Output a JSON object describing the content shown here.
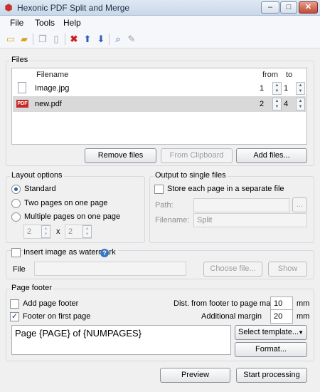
{
  "window": {
    "title": "Hexonic PDF Split and Merge",
    "app_icon": "hexagon-icon",
    "minimize_glyph": "–",
    "maximize_glyph": "□",
    "close_glyph": "✕"
  },
  "menu": [
    "File",
    "Tools",
    "Help"
  ],
  "toolbar": {
    "icons": [
      "new-icon",
      "open-folder-icon",
      "copy-icon",
      "paste-icon",
      "delete-icon",
      "move-up-icon",
      "move-down-icon",
      "search-icon",
      "edit-icon"
    ],
    "glyphs": {
      "new": "▭",
      "open": "▰",
      "copy": "❐",
      "paste": "▯",
      "delete": "✖",
      "up": "⬆",
      "down": "⬇",
      "search": "⌕",
      "edit": "✎"
    }
  },
  "files": {
    "group_label": "Files",
    "columns": {
      "filename": "Filename",
      "from": "from",
      "to": "to"
    },
    "rows": [
      {
        "icon": "blank-file-icon",
        "name": "Image.jpg",
        "from": "1",
        "to": "1",
        "selected": false
      },
      {
        "icon": "pdf-file-icon",
        "name": "new.pdf",
        "from": "2",
        "to": "4",
        "selected": true
      }
    ],
    "pdf_badge": "PDF",
    "buttons": {
      "remove": "Remove files",
      "clipboard": "From Clipboard",
      "add": "Add files..."
    }
  },
  "layout_options": {
    "group_label": "Layout options",
    "options": [
      "Standard",
      "Two pages on one page",
      "Multiple pages on one page"
    ],
    "selected": "Standard",
    "cols": "2",
    "rows": "2",
    "times": "x"
  },
  "output": {
    "group_label": "Output to single files",
    "store_label": "Store each page in a separate file",
    "path_label": "Path:",
    "path_value": "",
    "browse_label": "...",
    "filename_label": "Filename:",
    "filename_value": "Split"
  },
  "watermark": {
    "checkbox_label": "Insert image as watermark",
    "file_label": "File",
    "file_value": "",
    "choose_label": "Choose file...",
    "show_label": "Show",
    "help_glyph": "?"
  },
  "footer": {
    "group_label": "Page footer",
    "add_label": "Add page footer",
    "add_checked": false,
    "first_label": "Footer on first page",
    "first_checked": true,
    "check_glyph": "✓",
    "dist_label": "Dist. from footer to page margin",
    "dist_value": "10",
    "dist_unit": "mm",
    "margin_label": "Additional margin",
    "margin_value": "20",
    "margin_unit": "mm",
    "text": "Page {PAGE} of {NUMPAGES}",
    "template_label": "Select template...",
    "format_label": "Format..."
  },
  "actions": {
    "preview": "Preview",
    "start": "Start processing"
  },
  "spin_up": "▲",
  "spin_down": "▼",
  "combo_arrow": "▼"
}
